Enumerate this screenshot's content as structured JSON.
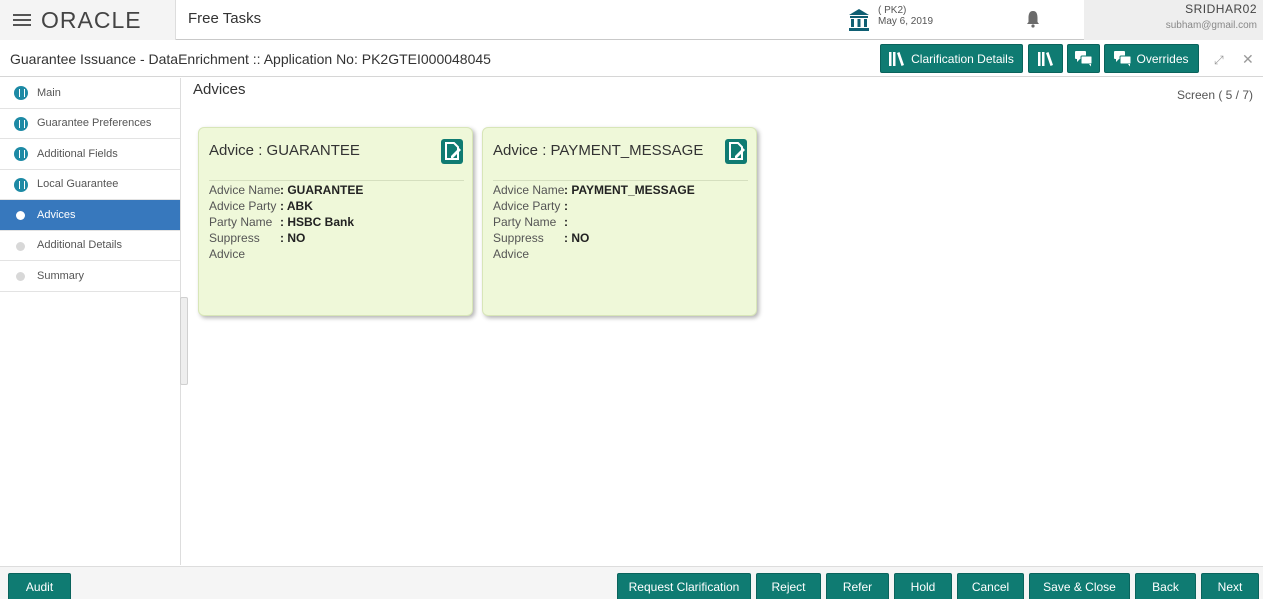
{
  "topbar": {
    "brand": "ORACLE",
    "app_title": "Free Tasks",
    "branch_code": "( PK2)",
    "branch_date": "May 6, 2019",
    "user_name": "SRIDHAR02",
    "user_email": "subham@gmail.com"
  },
  "subheader": {
    "title": "Guarantee Issuance - DataEnrichment :: Application No: PK2GTEI000048045",
    "clarification_label": "Clarification Details",
    "overrides_label": "Overrides"
  },
  "sidebar": {
    "items": [
      {
        "label": "Main",
        "state": "done"
      },
      {
        "label": "Guarantee Preferences",
        "state": "done"
      },
      {
        "label": "Additional Fields",
        "state": "done"
      },
      {
        "label": "Local Guarantee",
        "state": "done"
      },
      {
        "label": "Advices",
        "state": "active"
      },
      {
        "label": "Additional Details",
        "state": "pending"
      },
      {
        "label": "Summary",
        "state": "pending"
      }
    ]
  },
  "content": {
    "section_title": "Advices",
    "screen_indicator": "Screen ( 5 / 7)",
    "cards": [
      {
        "title": "Advice : GUARANTEE",
        "rows": [
          {
            "key": "Advice Name",
            "value": ": GUARANTEE"
          },
          {
            "key": "Advice Party",
            "value": ": ABK"
          },
          {
            "key": "Party Name",
            "value": ": HSBC Bank"
          },
          {
            "key": "Suppress",
            "value": ": NO"
          },
          {
            "key": "Advice",
            "value": ""
          }
        ]
      },
      {
        "title": "Advice : PAYMENT_MESSAGE",
        "rows": [
          {
            "key": "Advice Name",
            "value": ": PAYMENT_MESSAGE"
          },
          {
            "key": "Advice Party",
            "value": ":"
          },
          {
            "key": "Party Name",
            "value": ":"
          },
          {
            "key": "Suppress",
            "value": ": NO"
          },
          {
            "key": "Advice",
            "value": ""
          }
        ]
      }
    ]
  },
  "footer": {
    "audit": "Audit",
    "request_clarification": "Request Clarification",
    "reject": "Reject",
    "refer": "Refer",
    "hold": "Hold",
    "cancel": "Cancel",
    "save_close": "Save & Close",
    "back": "Back",
    "next": "Next"
  },
  "colors": {
    "accent": "#0f7b72",
    "active_step": "#3778bd",
    "card_bg": "#eff8d9",
    "step_dot": "#1d8aa5"
  },
  "icons": [
    "hamburger-icon",
    "bank-icon",
    "bell-icon",
    "library-icon",
    "chat-icon",
    "edit-document-icon",
    "minimize-icon",
    "close-icon"
  ]
}
